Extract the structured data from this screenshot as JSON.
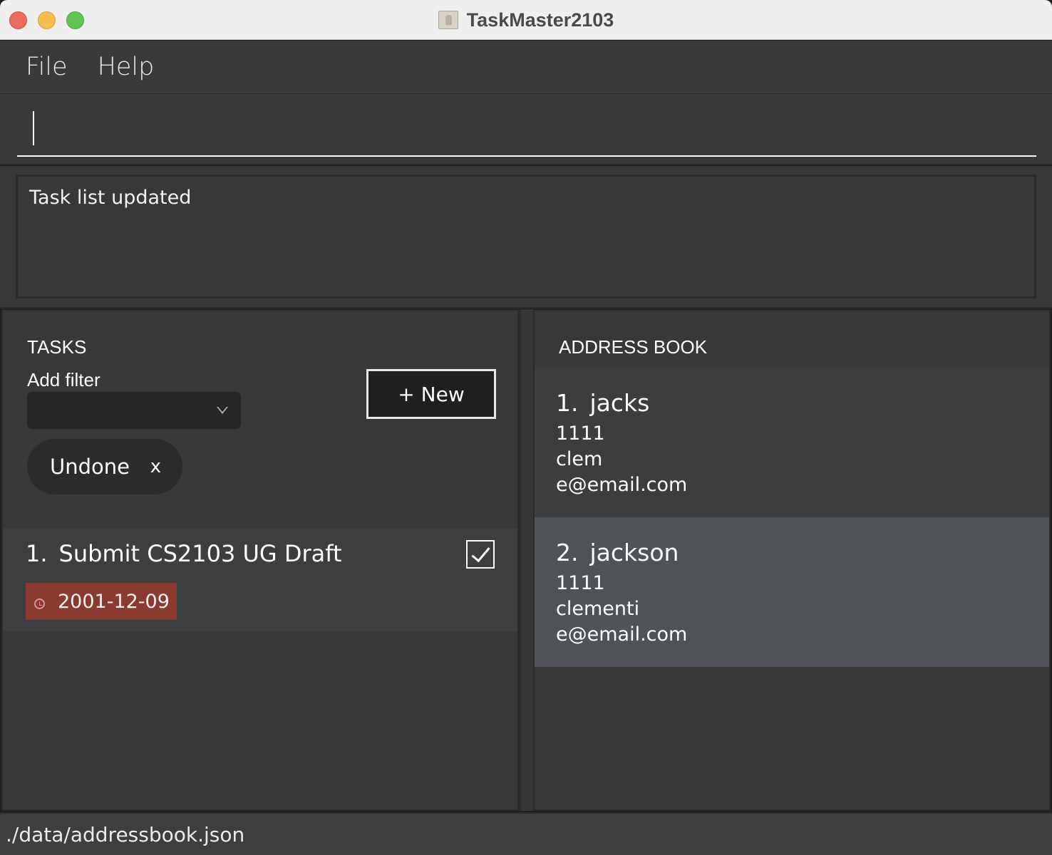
{
  "window": {
    "title": "TaskMaster2103",
    "icon": "address-book-app-icon"
  },
  "menubar": {
    "items": [
      {
        "label": "File"
      },
      {
        "label": "Help"
      }
    ]
  },
  "command": {
    "value": ""
  },
  "result": {
    "message": "Task list updated"
  },
  "tasks": {
    "title": "TASKS",
    "filter_label": "Add filter",
    "filter_selected": "",
    "new_button": "+ New",
    "active_filters": [
      {
        "label": "Undone",
        "remove": "x"
      }
    ],
    "items": [
      {
        "index": "1.",
        "title": "Submit CS2103 UG Draft",
        "done": true,
        "deadline": "2001-12-09",
        "deadline_color": "#8b3a30"
      }
    ]
  },
  "address_book": {
    "title": "ADDRESS BOOK",
    "persons": [
      {
        "index": "1.",
        "name": "jacks",
        "phone": "1111",
        "address": "clem",
        "email": "e@email.com"
      },
      {
        "index": "2.",
        "name": "jackson",
        "phone": "1111",
        "address": "clementi",
        "email": "e@email.com",
        "selected": true
      }
    ]
  },
  "status_bar": {
    "path": "./data/addressbook.json"
  },
  "colors": {
    "background": "#383838",
    "selected_row": "#4f5357",
    "deadline_overdue": "#8b3a30"
  }
}
